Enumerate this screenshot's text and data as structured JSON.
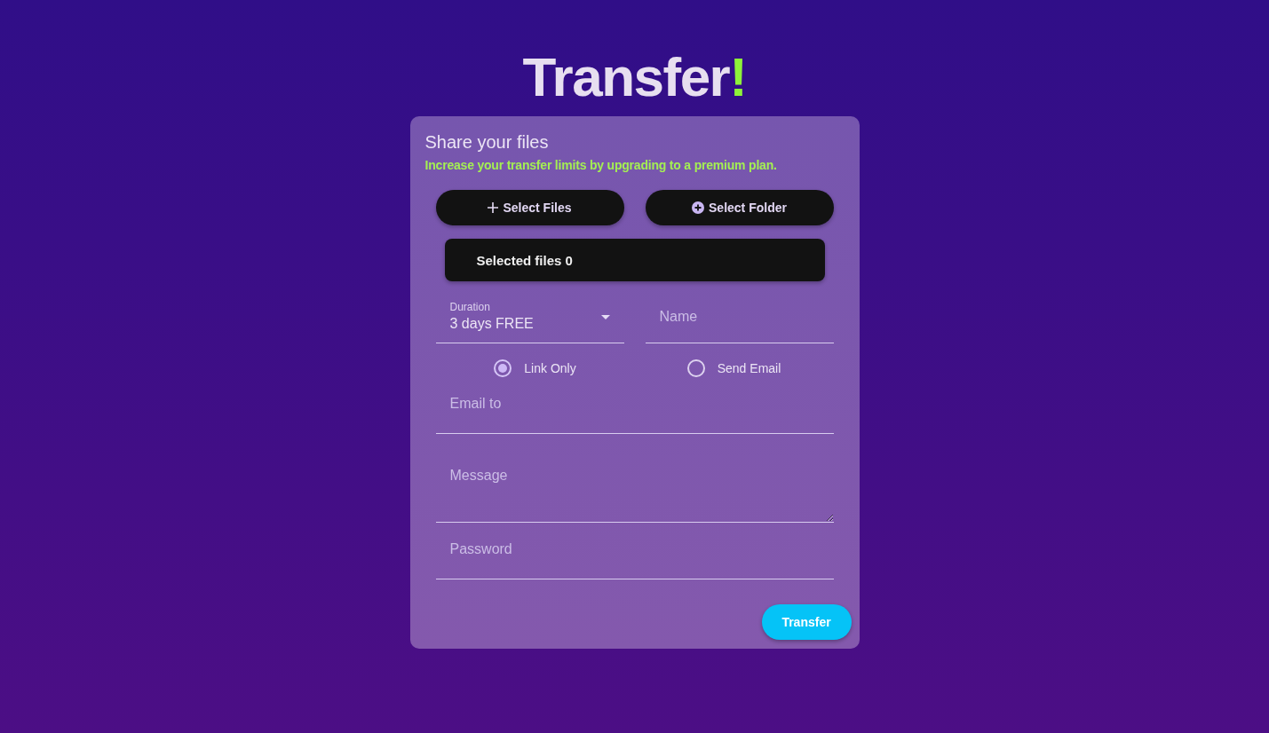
{
  "title": {
    "text": "Transfer",
    "accent": "!"
  },
  "card": {
    "heading": "Share your files",
    "notice": "Increase your transfer limits by upgrading to a premium plan.",
    "buttons": [
      {
        "label": "Select Files",
        "kind": "plus"
      },
      {
        "label": "Select Folder",
        "kind": "circle-plus"
      }
    ],
    "selected_files": "Selected files 0",
    "duration": {
      "label": "Duration",
      "value": "3 days FREE"
    },
    "name_field": {
      "placeholder": "Name"
    },
    "delivery": [
      {
        "label": "Link Only",
        "selected": true
      },
      {
        "label": "Send Email",
        "selected": false
      }
    ],
    "fields": [
      {
        "kind": "email",
        "placeholder": "Email to"
      },
      {
        "kind": "textarea",
        "placeholder": "Message"
      },
      {
        "kind": "password",
        "placeholder": "Password"
      }
    ],
    "submit": "Transfer"
  }
}
